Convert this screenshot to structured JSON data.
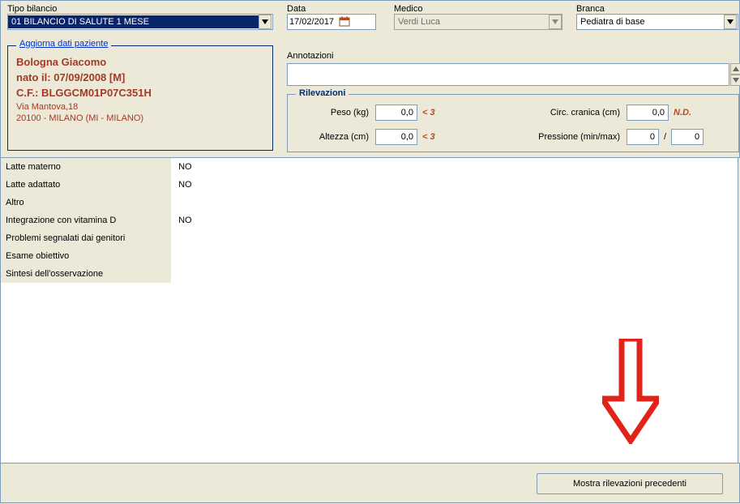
{
  "header": {
    "tipo_label": "Tipo bilancio",
    "tipo_value": "01 BILANCIO DI SALUTE 1 MESE",
    "data_label": "Data",
    "data_value": "17/02/2017",
    "medico_label": "Medico",
    "medico_value": "Verdi Luca",
    "branca_label": "Branca",
    "branca_value": "Pediatra di base"
  },
  "patient": {
    "update_link": "Aggiorna dati paziente",
    "name": "Bologna Giacomo",
    "birth_line": "nato il:  07/09/2008    [M]",
    "cf_line": "C.F.: BLGGCM01P07C351H",
    "address": "Via Mantova,18",
    "city": "20100 - MILANO (MI - MILANO)"
  },
  "annot": {
    "label": "Annotazioni",
    "value": ""
  },
  "rilev": {
    "legend": "Rilevazioni",
    "peso_label": "Peso (kg)",
    "peso_value": "0,0",
    "peso_ref": "< 3",
    "altezza_label": "Altezza (cm)",
    "altezza_value": "0,0",
    "altezza_ref": "< 3",
    "circ_label": "Circ. cranica (cm)",
    "circ_value": "0,0",
    "circ_ref": "N.D.",
    "press_label": "Pressione (min/max)",
    "press_min": "0",
    "press_max": "0",
    "press_sep": "/"
  },
  "list": {
    "items": [
      {
        "label": "Latte materno",
        "value": "NO"
      },
      {
        "label": "Latte adattato",
        "value": "NO"
      },
      {
        "label": "Altro",
        "value": ""
      },
      {
        "label": "Integrazione con vitamina D",
        "value": "NO"
      },
      {
        "label": "Problemi segnalati dai genitori",
        "value": ""
      },
      {
        "label": "Esame obiettivo",
        "value": ""
      },
      {
        "label": "Sintesi dell'osservazione",
        "value": ""
      }
    ]
  },
  "footer": {
    "show_prev": "Mostra rilevazioni precedenti"
  }
}
